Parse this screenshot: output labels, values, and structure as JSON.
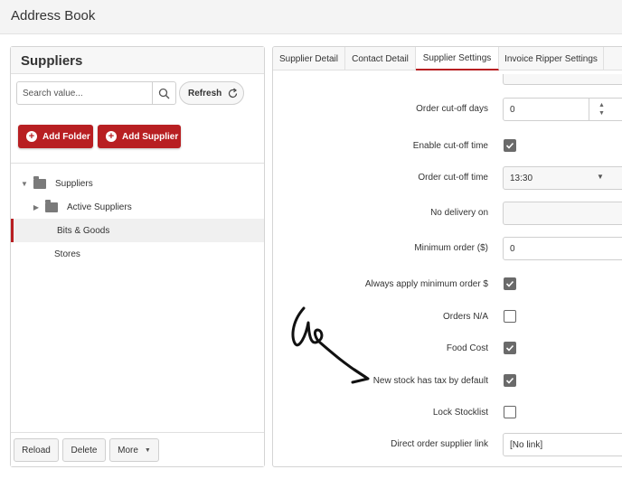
{
  "app": {
    "title": "Address Book"
  },
  "suppliers_panel": {
    "title": "Suppliers",
    "search": {
      "placeholder": "Search value...",
      "value": ""
    },
    "refresh_label": "Refresh",
    "add_folder_label": "Add Folder",
    "add_supplier_label": "Add Supplier",
    "tree": [
      {
        "label": "Suppliers",
        "level": 0,
        "expanded": true,
        "folder": true
      },
      {
        "label": "Active Suppliers",
        "level": 1,
        "expanded": false,
        "folder": true
      },
      {
        "label": "Bits & Goods",
        "level": 1,
        "selected": true,
        "folder": false
      },
      {
        "label": "Stores",
        "level": 1,
        "folder": false
      }
    ],
    "footer": {
      "reload_label": "Reload",
      "delete_label": "Delete",
      "more_label": "More"
    }
  },
  "detail_panel": {
    "tabs": [
      {
        "label": "Supplier Detail",
        "active": false
      },
      {
        "label": "Contact Detail",
        "active": false
      },
      {
        "label": "Supplier Settings",
        "active": true
      },
      {
        "label": "Invoice Ripper Settings",
        "active": false
      }
    ],
    "settings": {
      "order_cutoff_days": {
        "label": "Order cut-off days",
        "value": "0"
      },
      "enable_cutoff_time": {
        "label": "Enable cut-off time",
        "checked": true
      },
      "order_cutoff_time": {
        "label": "Order cut-off time",
        "value": "13:30"
      },
      "no_delivery_on": {
        "label": "No delivery on",
        "value": ""
      },
      "minimum_order": {
        "label": "Minimum order ($)",
        "value": "0"
      },
      "always_apply_minimum": {
        "label": "Always apply minimum order $",
        "checked": true
      },
      "orders_na": {
        "label": "Orders N/A",
        "checked": false
      },
      "food_cost": {
        "label": "Food Cost",
        "checked": true
      },
      "new_stock_tax": {
        "label": "New stock has tax by default",
        "checked": true
      },
      "lock_stocklist": {
        "label": "Lock Stocklist",
        "checked": false
      },
      "direct_order_link": {
        "label": "Direct order supplier link",
        "value": "[No link]"
      }
    }
  },
  "colors": {
    "accent": "#b81f22",
    "checkbox_checked": "#6a6a6a"
  },
  "icons": [
    "search-icon",
    "refresh-icon",
    "plus-circle-icon",
    "folder-icon",
    "chevron-down-icon",
    "chevron-right-icon",
    "stepper-icon",
    "check-icon",
    "hand-drawn-arrow-icon"
  ]
}
